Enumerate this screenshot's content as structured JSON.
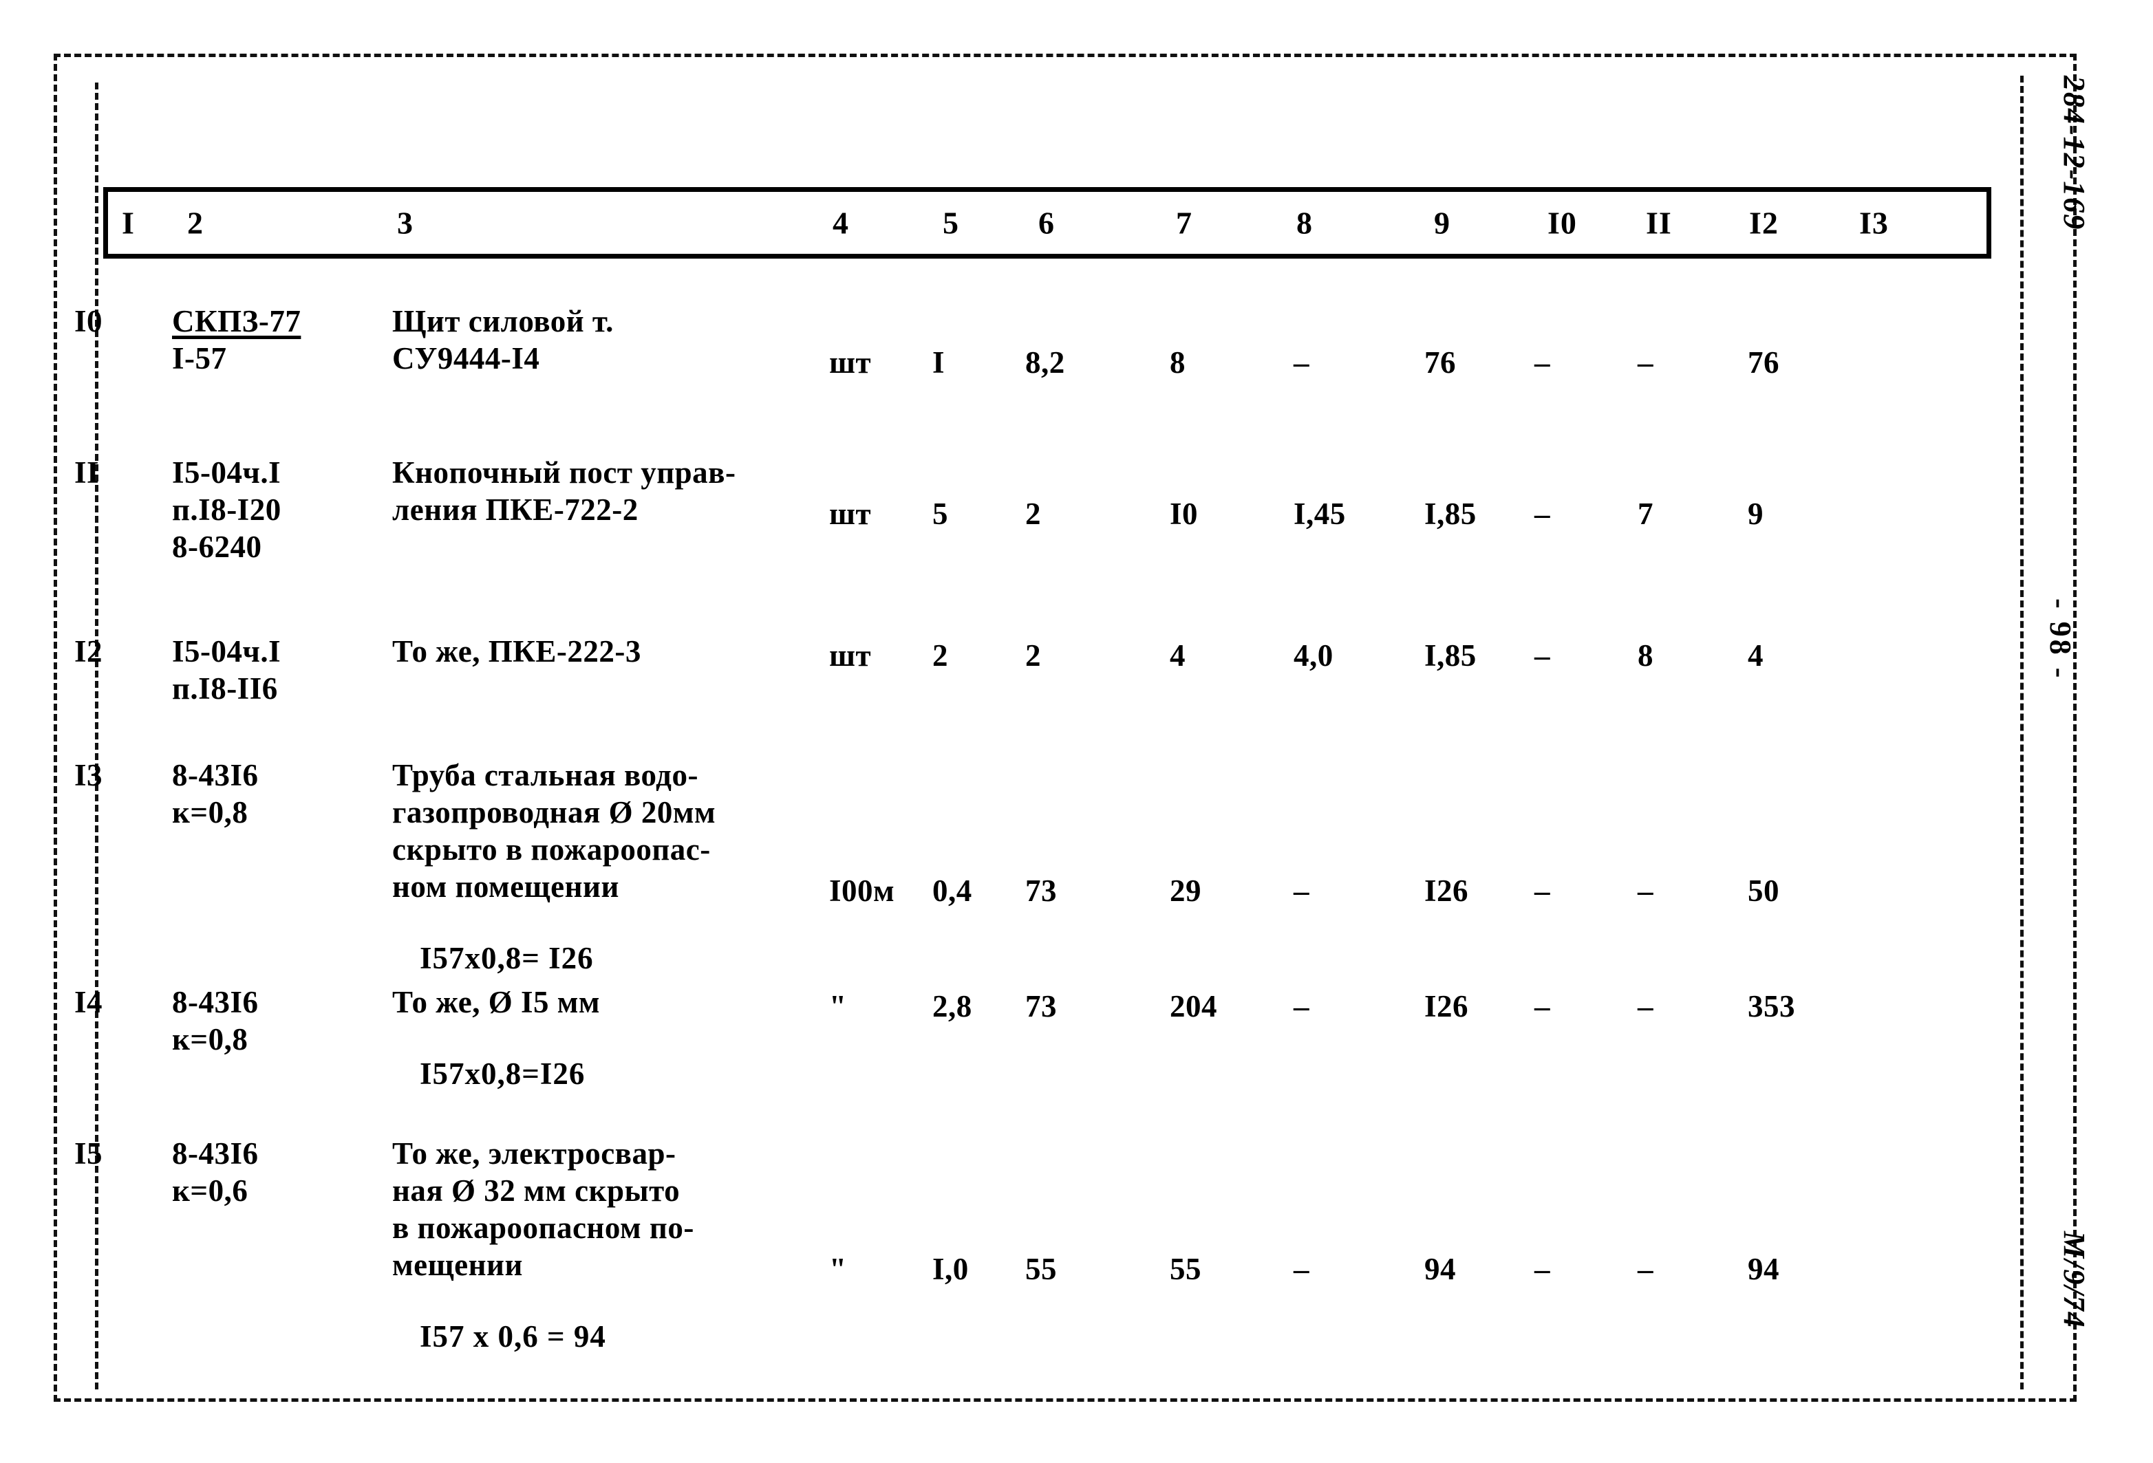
{
  "document": {
    "margin_code": "284-12-169",
    "page_marker": "- 98 -",
    "signature": "М/9/74"
  },
  "table": {
    "column_headers": [
      "I",
      "2",
      "3",
      "4",
      "5",
      "6",
      "7",
      "8",
      "9",
      "I0",
      "II",
      "I2",
      "I3"
    ],
    "rows": [
      {
        "no": "I0",
        "code_lines": [
          "СКПЗ-77",
          "I-57"
        ],
        "code_is_fraction": true,
        "desc_lines": [
          "Щит силовой т.",
          "СУ9444-I4"
        ],
        "formula": "",
        "unit": "шт",
        "c5": "I",
        "c6": "8,2",
        "c7": "8",
        "c8": "–",
        "c9": "76",
        "c10": "–",
        "c11": "–",
        "c12": "76",
        "c13": ""
      },
      {
        "no": "II",
        "code_lines": [
          "I5-04ч.I",
          "п.I8-I20",
          "8-6240"
        ],
        "code_is_fraction": false,
        "desc_lines": [
          "Кнопочный пост управ-",
          "ления ПКЕ-722-2"
        ],
        "formula": "",
        "unit": "шт",
        "c5": "5",
        "c6": "2",
        "c7": "I0",
        "c8": "I,45",
        "c9": "I,85",
        "c10": "–",
        "c11": "7",
        "c12": "9",
        "c13": ""
      },
      {
        "no": "I2",
        "code_lines": [
          "I5-04ч.I",
          "п.I8-II6"
        ],
        "code_is_fraction": false,
        "desc_lines": [
          "То же, ПКЕ-222-3"
        ],
        "formula": "",
        "unit": "шт",
        "c5": "2",
        "c6": "2",
        "c7": "4",
        "c8": "4,0",
        "c9": "I,85",
        "c10": "–",
        "c11": "8",
        "c12": "4",
        "c13": ""
      },
      {
        "no": "I3",
        "code_lines": [
          "8-43I6",
          "к=0,8"
        ],
        "code_is_fraction": false,
        "desc_lines": [
          "Труба стальная водо-",
          "газопроводная Ø 20мм",
          "скрыто в пожароопас-",
          "ном помещении"
        ],
        "formula": "I57x0,8= I26",
        "unit": "I00м",
        "c5": "0,4",
        "c6": "73",
        "c7": "29",
        "c8": "–",
        "c9": "I26",
        "c10": "–",
        "c11": "–",
        "c12": "50",
        "c13": ""
      },
      {
        "no": "I4",
        "code_lines": [
          "8-43I6",
          "к=0,8"
        ],
        "code_is_fraction": false,
        "desc_lines": [
          "То же, Ø I5 мм"
        ],
        "formula": "I57x0,8=I26",
        "unit": "\"",
        "c5": "2,8",
        "c6": "73",
        "c7": "204",
        "c8": "–",
        "c9": "I26",
        "c10": "–",
        "c11": "–",
        "c12": "353",
        "c13": ""
      },
      {
        "no": "I5",
        "code_lines": [
          "8-43I6",
          "к=0,6"
        ],
        "code_is_fraction": false,
        "desc_lines": [
          "То же, электросвар-",
          "ная Ø 32 мм скрыто",
          "в пожароопасном по-",
          "мещении"
        ],
        "formula": "I57 x 0,6 = 94",
        "unit": "\"",
        "c5": "I,0",
        "c6": "55",
        "c7": "55",
        "c8": "–",
        "c9": "94",
        "c10": "–",
        "c11": "–",
        "c12": "94",
        "c13": ""
      }
    ]
  }
}
